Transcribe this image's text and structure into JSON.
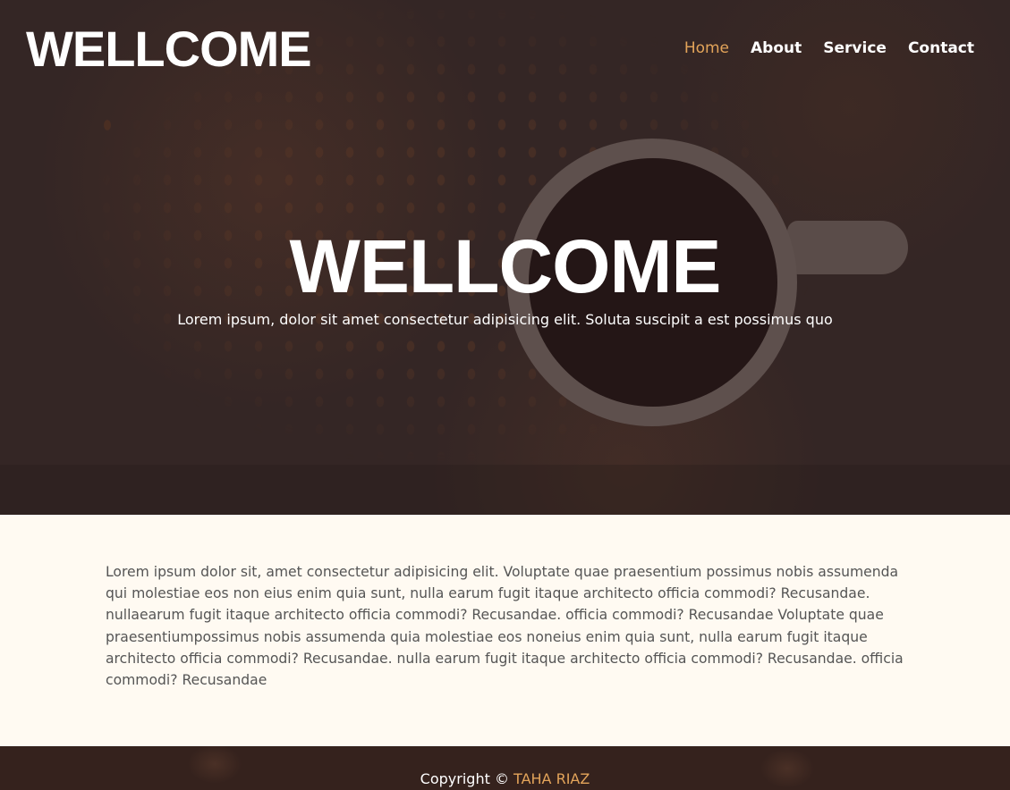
{
  "header": {
    "logo": "WELLCOME",
    "nav": [
      {
        "label": "Home",
        "active": true
      },
      {
        "label": "About"
      },
      {
        "label": "Service"
      },
      {
        "label": "Contact"
      }
    ]
  },
  "hero": {
    "title": "WELLCOME",
    "subtitle": "Lorem ipsum, dolor sit amet consectetur adipisicing elit. Soluta suscipit a est possimus quo"
  },
  "content": {
    "paragraph": "Lorem ipsum dolor sit, amet consectetur adipisicing elit. Voluptate quae praesentium possimus nobis assumenda qui molestiae eos non eius enim quia sunt, nulla earum fugit itaque architecto officia commodi? Recusandae. nullaearum fugit itaque architecto officia commodi? Recusandae. officia commodi? Recusandae Voluptate quae praesentiumpossimus nobis assumenda quia molestiae eos noneius enim quia sunt, nulla earum fugit itaque architecto officia commodi? Recusandae. nulla earum fugit itaque architecto officia commodi? Recusandae. officia commodi? Recusandae"
  },
  "footer": {
    "prefix": "Copyright © ",
    "name": "TAHA RIAZ"
  },
  "colors": {
    "accent": "#e3a45a",
    "content_bg": "#fffaf2",
    "hero_bg": "#342625"
  }
}
